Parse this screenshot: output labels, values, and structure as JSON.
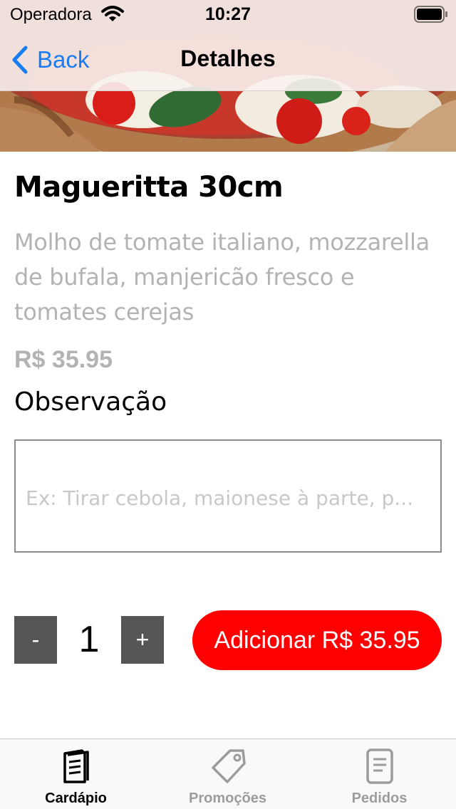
{
  "status_bar": {
    "carrier": "Operadora",
    "time": "10:27"
  },
  "nav": {
    "back_label": "Back",
    "title": "Detalhes"
  },
  "product": {
    "name": "Magueritta 30cm",
    "description": "Molho de tomate italiano, mozzarella de bufala, manjericão fresco e tomates cerejas",
    "price": "R$ 35.95"
  },
  "observation": {
    "label": "Observação",
    "placeholder": "Ex: Tirar cebola, maionese à parte, p..."
  },
  "quantity": {
    "minus_label": "-",
    "value": "1",
    "plus_label": "+"
  },
  "add_button_label": "Adicionar R$ 35.95",
  "colors": {
    "accent_blue": "#1a7cf2",
    "add_button_red": "#ff0000",
    "quantity_button_gray": "#555555",
    "muted_text": "#b3b3b3"
  },
  "tab_bar": {
    "active_tab": "Cardápio",
    "tabs": [
      {
        "label": "Cardápio",
        "icon": "menu-book-icon"
      },
      {
        "label": "Promoções",
        "icon": "tag-icon"
      },
      {
        "label": "Pedidos",
        "icon": "receipt-icon"
      }
    ]
  }
}
